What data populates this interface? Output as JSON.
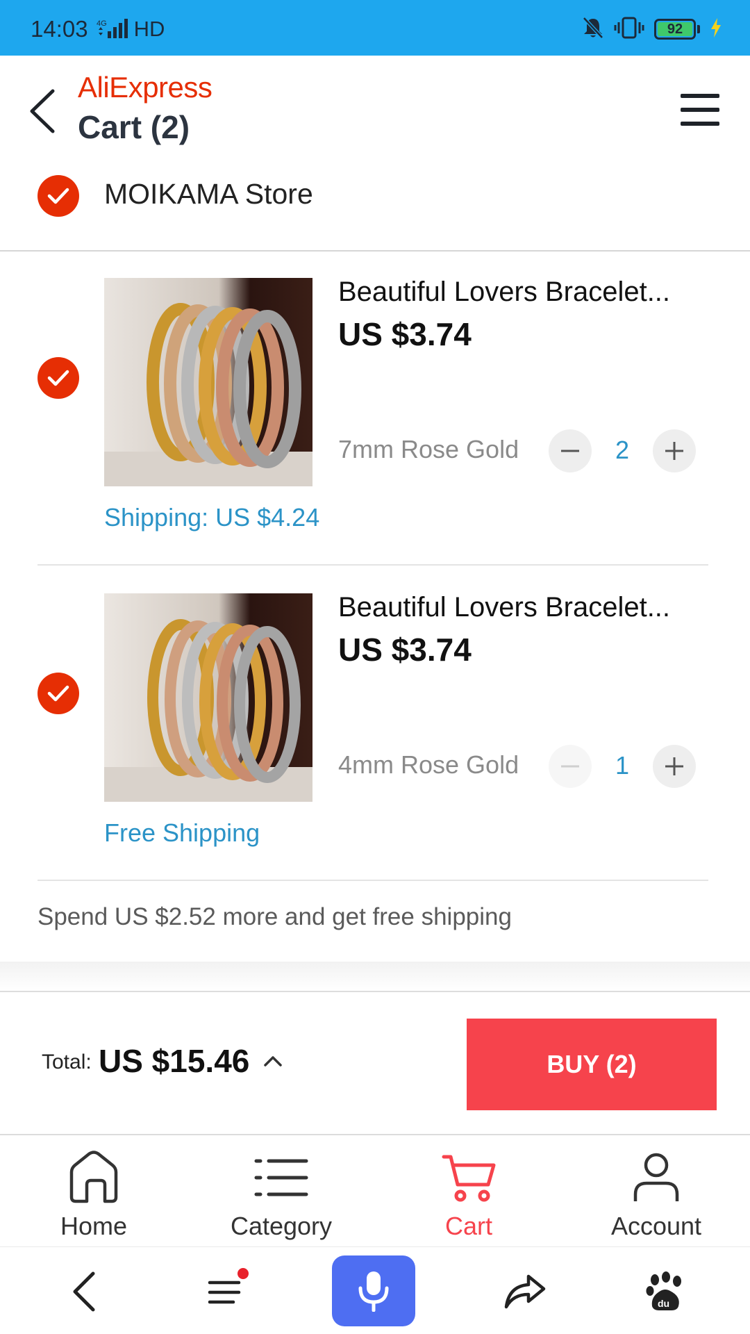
{
  "status_bar": {
    "time": "14:03",
    "network": "4G",
    "hd": "HD",
    "battery": "92"
  },
  "header": {
    "brand": "AliExpress",
    "title": "Cart (2)"
  },
  "store": {
    "name": "MOIKAMA Store",
    "checked": true
  },
  "items": [
    {
      "title": "Beautiful Lovers Bracelet...",
      "price": "US $3.74",
      "variant": "7mm Rose Gold",
      "quantity": "2",
      "shipping": "Shipping: US $4.24",
      "checked": true
    },
    {
      "title": "Beautiful Lovers Bracelet...",
      "price": "US $3.74",
      "variant": "4mm Rose Gold",
      "quantity": "1",
      "shipping": "Free Shipping",
      "checked": true
    }
  ],
  "free_shipping_message": "Spend US $2.52 more and get free shipping",
  "summary": {
    "total_label": "Total:",
    "total_value": "US $15.46",
    "buy_label": "BUY (2)"
  },
  "bottom_nav": [
    {
      "label": "Home",
      "icon": "home-icon"
    },
    {
      "label": "Category",
      "icon": "category-icon"
    },
    {
      "label": "Cart",
      "icon": "cart-icon",
      "active": true
    },
    {
      "label": "Account",
      "icon": "account-icon"
    }
  ],
  "system_nav": {
    "icons": [
      "back-arrow-icon",
      "list-menu-icon",
      "microphone-icon",
      "share-icon",
      "baidu-paw-icon"
    ]
  },
  "colors": {
    "accent": "#e62e04",
    "buy": "#f6434c",
    "link": "#2b93c7",
    "status_bar": "#1ea7ee",
    "mic": "#4e6ef2"
  }
}
